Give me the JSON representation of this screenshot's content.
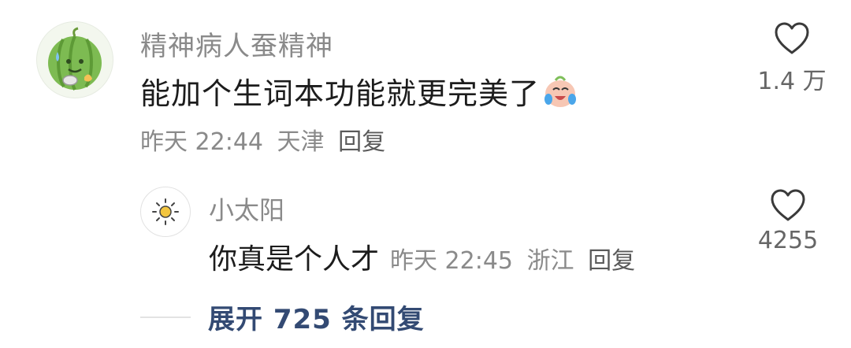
{
  "main_comment": {
    "username": "精神病人蚕精神",
    "content": "能加个生词本功能就更完美了",
    "content_emoji": "crying-laughing-emoji",
    "time": "昨天 22:44",
    "location": "天津",
    "reply_label": "回复",
    "like_count": "1.4 万",
    "avatar_icon": "watermelon-avatar-icon"
  },
  "reply_comment": {
    "username": "小太阳",
    "content": "你真是个人才",
    "time": "昨天 22:45",
    "location": "浙江",
    "reply_label": "回复",
    "like_count": "4255",
    "avatar_icon": "sun-avatar-icon"
  },
  "expand": {
    "label": "展开 725 条回复"
  },
  "colors": {
    "muted": "#8a8a8a",
    "text": "#1c1c1c",
    "link": "#334a73"
  }
}
